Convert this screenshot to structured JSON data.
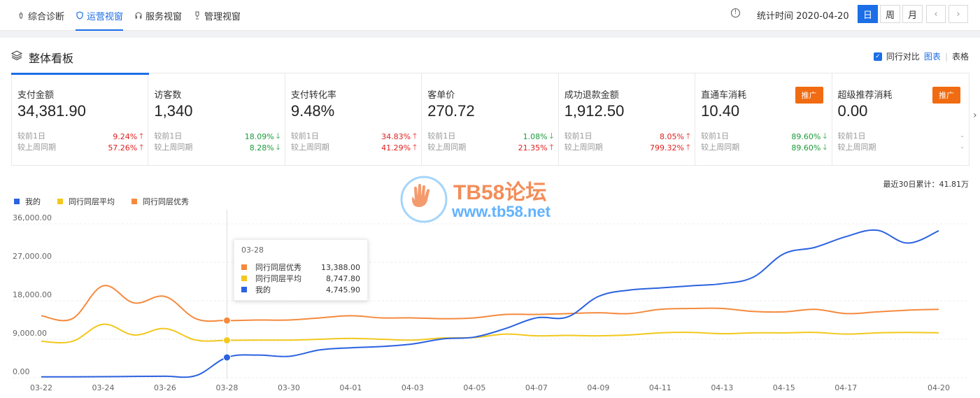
{
  "nav": {
    "tabs": [
      {
        "label": "综合诊断",
        "icon": "diagnosis-icon"
      },
      {
        "label": "运营视窗",
        "icon": "shield-icon"
      },
      {
        "label": "服务视窗",
        "icon": "headset-icon"
      },
      {
        "label": "管理视窗",
        "icon": "trophy-icon"
      }
    ],
    "active_tab": 1,
    "stat_time": "统计时间 2020-04-20",
    "period": [
      "日",
      "周",
      "月"
    ],
    "active_period": 0,
    "prev": "‹",
    "next": "›"
  },
  "panel": {
    "title": "整体看板",
    "compare_label": "同行对比",
    "view_chart": "图表",
    "view_table": "表格",
    "compare_checked": true
  },
  "cards": [
    {
      "label": "支付金额",
      "value": "34,381.90",
      "d1_label": "较前1日",
      "d1": "9.24%",
      "d1_dir": "up",
      "w_label": "较上周同期",
      "w": "57.26%",
      "w_dir": "up"
    },
    {
      "label": "访客数",
      "value": "1,340",
      "d1_label": "较前1日",
      "d1": "18.09%",
      "d1_dir": "down",
      "w_label": "较上周同期",
      "w": "8.28%",
      "w_dir": "down"
    },
    {
      "label": "支付转化率",
      "value": "9.48%",
      "d1_label": "较前1日",
      "d1": "34.83%",
      "d1_dir": "up",
      "w_label": "较上周同期",
      "w": "41.29%",
      "w_dir": "up"
    },
    {
      "label": "客单价",
      "value": "270.72",
      "d1_label": "较前1日",
      "d1": "1.08%",
      "d1_dir": "down",
      "w_label": "较上周同期",
      "w": "21.35%",
      "w_dir": "up"
    },
    {
      "label": "成功退款金额",
      "value": "1,912.50",
      "d1_label": "较前1日",
      "d1": "8.05%",
      "d1_dir": "up",
      "w_label": "较上周同期",
      "w": "799.32%",
      "w_dir": "up"
    },
    {
      "label": "直通车消耗",
      "value": "10.40",
      "d1_label": "较前1日",
      "d1": "89.60%",
      "d1_dir": "down",
      "w_label": "较上周同期",
      "w": "89.60%",
      "w_dir": "down",
      "promo": "推广"
    },
    {
      "label": "超级推荐消耗",
      "value": "0.00",
      "d1_label": "较前1日",
      "d1": "-",
      "d1_dir": "none",
      "w_label": "较上周同期",
      "w": "-",
      "w_dir": "none",
      "promo": "推广"
    }
  ],
  "summary": "最近30日累计：41.81万",
  "watermark": {
    "title": "TB58论坛",
    "url": "www.tb58.net"
  },
  "colors": {
    "mine": "#2b62e0",
    "avg": "#f2c81e",
    "best": "#f58a3d",
    "accent": "#1b6ee6",
    "up": "#e02020",
    "down": "#1a9b3a",
    "promo": "#f06b11"
  },
  "tooltip": {
    "date": "03-28",
    "rows": [
      {
        "name": "同行同层优秀",
        "value": "13,388.00",
        "color": "#f58a3d"
      },
      {
        "name": "同行同层平均",
        "value": "8,747.80",
        "color": "#f2c81e"
      },
      {
        "name": "我的",
        "value": "4,745.90",
        "color": "#2b62e0"
      }
    ]
  },
  "chart_data": {
    "type": "line",
    "x": [
      "03-22",
      "03-23",
      "03-24",
      "03-25",
      "03-26",
      "03-27",
      "03-28",
      "03-29",
      "03-30",
      "03-31",
      "04-01",
      "04-02",
      "04-03",
      "04-04",
      "04-05",
      "04-06",
      "04-07",
      "04-08",
      "04-09",
      "04-10",
      "04-11",
      "04-12",
      "04-13",
      "04-14",
      "04-15",
      "04-16",
      "04-17",
      "04-18",
      "04-19",
      "04-20"
    ],
    "x_tick_labels": [
      "03-22",
      "03-24",
      "03-26",
      "03-28",
      "03-30",
      "04-01",
      "04-03",
      "04-05",
      "04-07",
      "04-09",
      "04-11",
      "04-13",
      "04-15",
      "04-17",
      "04-20"
    ],
    "y_tick_labels": [
      "36,000.00",
      "27,000.00",
      "18,000.00",
      "9,000.00",
      "0.00"
    ],
    "ylim": [
      0,
      36000
    ],
    "grid": true,
    "legend_position": "top-left",
    "series": [
      {
        "name": "我的",
        "color": "#2b62e0",
        "values": [
          200,
          200,
          250,
          300,
          350,
          500,
          4745.9,
          5300,
          5000,
          6500,
          7000,
          7300,
          7900,
          9100,
          9500,
          11500,
          14000,
          14200,
          19000,
          20500,
          21000,
          21500,
          22000,
          23500,
          29000,
          30500,
          33000,
          34500,
          31500,
          34381.9
        ]
      },
      {
        "name": "同行同层平均",
        "color": "#f2c81e",
        "values": [
          8500,
          8500,
          12500,
          10000,
          11500,
          8800,
          8747.8,
          8800,
          8800,
          9000,
          9200,
          9000,
          8800,
          9300,
          9400,
          10200,
          9800,
          9900,
          9800,
          10000,
          10500,
          10600,
          10300,
          10500,
          10500,
          10600,
          10200,
          10500,
          10600,
          10500
        ]
      },
      {
        "name": "同行同层优秀",
        "color": "#f58a3d",
        "values": [
          14500,
          13800,
          21500,
          17500,
          19000,
          13800,
          13388,
          13500,
          13500,
          14000,
          14500,
          14000,
          14000,
          13800,
          14000,
          14800,
          14800,
          15000,
          15200,
          15000,
          16000,
          16200,
          16200,
          15500,
          15400,
          16000,
          15000,
          15400,
          15800,
          16000
        ]
      }
    ],
    "highlight_index": 6
  }
}
